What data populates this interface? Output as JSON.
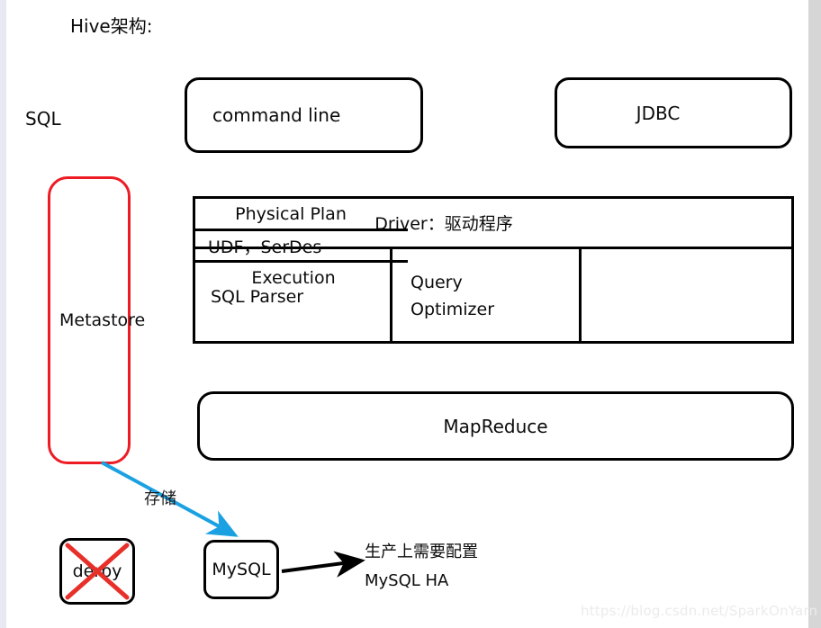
{
  "title": "Hive架构:",
  "sql_label": "SQL",
  "clients": {
    "command_line": "command line",
    "jdbc": "JDBC"
  },
  "metastore": {
    "label": "Metastore",
    "color": "#ed1c24"
  },
  "driver": {
    "header": "Driver：驱动程序",
    "columns": [
      {
        "label": "SQL Parser"
      },
      {
        "label": "Query\nOptimizer",
        "line1": "Query",
        "line2": "Optimizer"
      }
    ],
    "right_column": [
      "Physical Plan",
      "UDF，SerDes",
      "Execution"
    ]
  },
  "engine": {
    "mapreduce": "MapReduce"
  },
  "storage": {
    "arrow_label": "存储",
    "derby": "derby",
    "mysql": "MySQL",
    "derby_crossed_out": true,
    "arrow_color": "#1ba1e2",
    "cross_color": "#e8302a"
  },
  "note": {
    "line1": "生产上需要配置",
    "line2": "MySQL HA"
  },
  "watermark": "https://blog.csdn.net/SparkOnYarn"
}
